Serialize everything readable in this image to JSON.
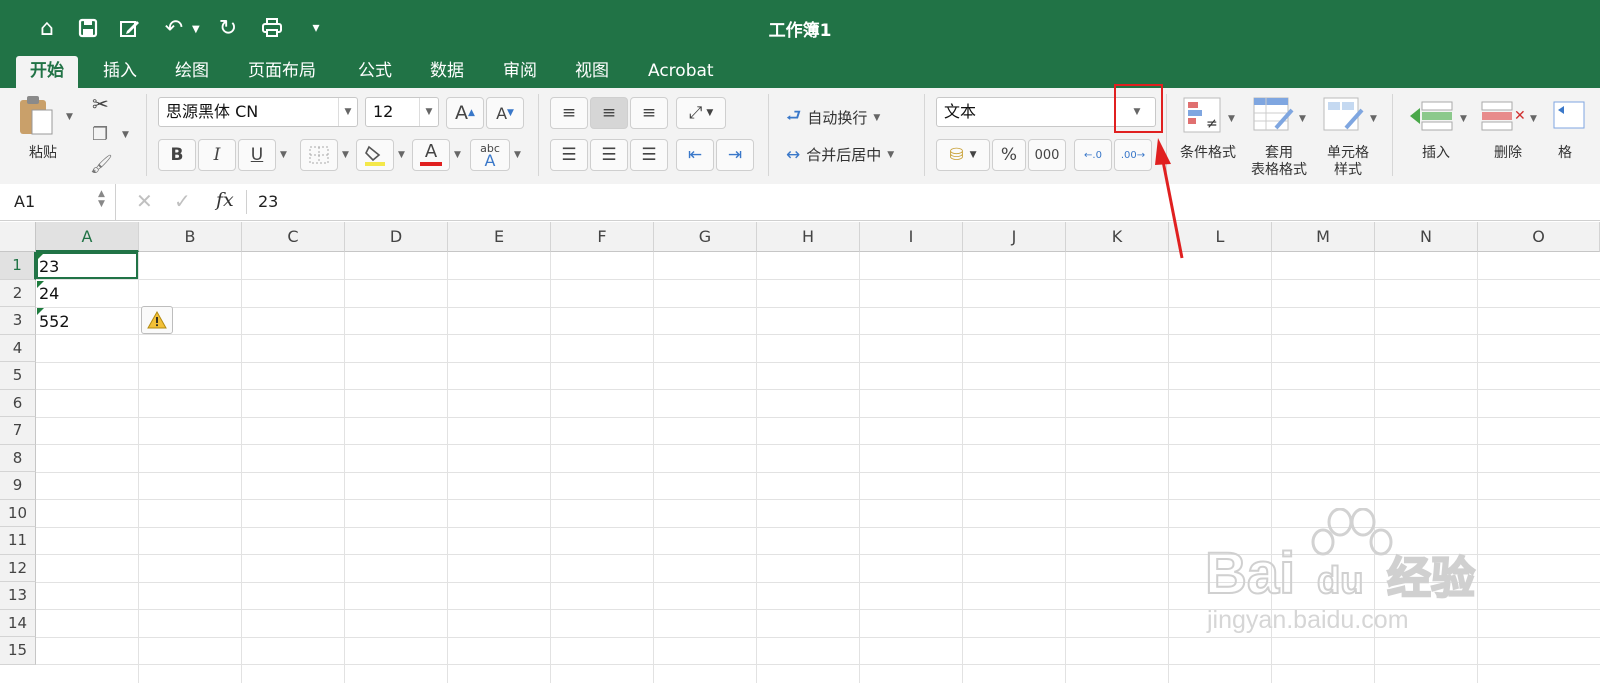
{
  "window": {
    "title": "工作簿1"
  },
  "quick_access": [
    {
      "name": "home-icon",
      "glyph": "⌂"
    },
    {
      "name": "save-icon",
      "glyph": "🖫"
    },
    {
      "name": "edit-icon",
      "glyph": "✎"
    },
    {
      "name": "undo-icon",
      "glyph": "↶"
    },
    {
      "name": "redo-icon",
      "glyph": "↻"
    },
    {
      "name": "print-icon",
      "glyph": "⎙"
    },
    {
      "name": "customize-icon",
      "glyph": "▾"
    }
  ],
  "tabs": [
    "开始",
    "插入",
    "绘图",
    "页面布局",
    "公式",
    "数据",
    "审阅",
    "视图",
    "Acrobat"
  ],
  "ribbon": {
    "paste_label": "粘贴",
    "font_name": "思源黑体 CN",
    "font_size": "12",
    "wrap_text": "自动换行",
    "merge_center": "合并后居中",
    "number_format": "文本",
    "percent": "%",
    "thousands": "000",
    "conditional_format": "条件格式",
    "table_format_1": "套用",
    "table_format_2": "表格格式",
    "cell_style_1": "单元格",
    "cell_style_2": "样式",
    "insert": "插入",
    "delete": "删除",
    "format_partial": "格",
    "bold": "B",
    "italic": "I",
    "underline": "U",
    "font_color_letter": "A",
    "orient_label": "abc"
  },
  "formula_bar": {
    "name_box": "A1",
    "fx": "fx",
    "value": "23"
  },
  "columns": [
    "A",
    "B",
    "C",
    "D",
    "E",
    "F",
    "G",
    "H",
    "I",
    "J",
    "K",
    "L",
    "M",
    "N",
    "O"
  ],
  "rows": [
    "1",
    "2",
    "3",
    "4",
    "5",
    "6",
    "7",
    "8",
    "9",
    "10",
    "11",
    "12",
    "13",
    "14",
    "15"
  ],
  "cells": [
    {
      "ref": "A1",
      "value": "23"
    },
    {
      "ref": "A2",
      "value": "24"
    },
    {
      "ref": "A3",
      "value": "552"
    }
  ],
  "colors": {
    "brand": "#217346",
    "annotation": "#e02020"
  },
  "watermark": {
    "line1": "Bai",
    "line2": "du",
    "line3": "经验",
    "url": "jingyan.baidu.com"
  }
}
